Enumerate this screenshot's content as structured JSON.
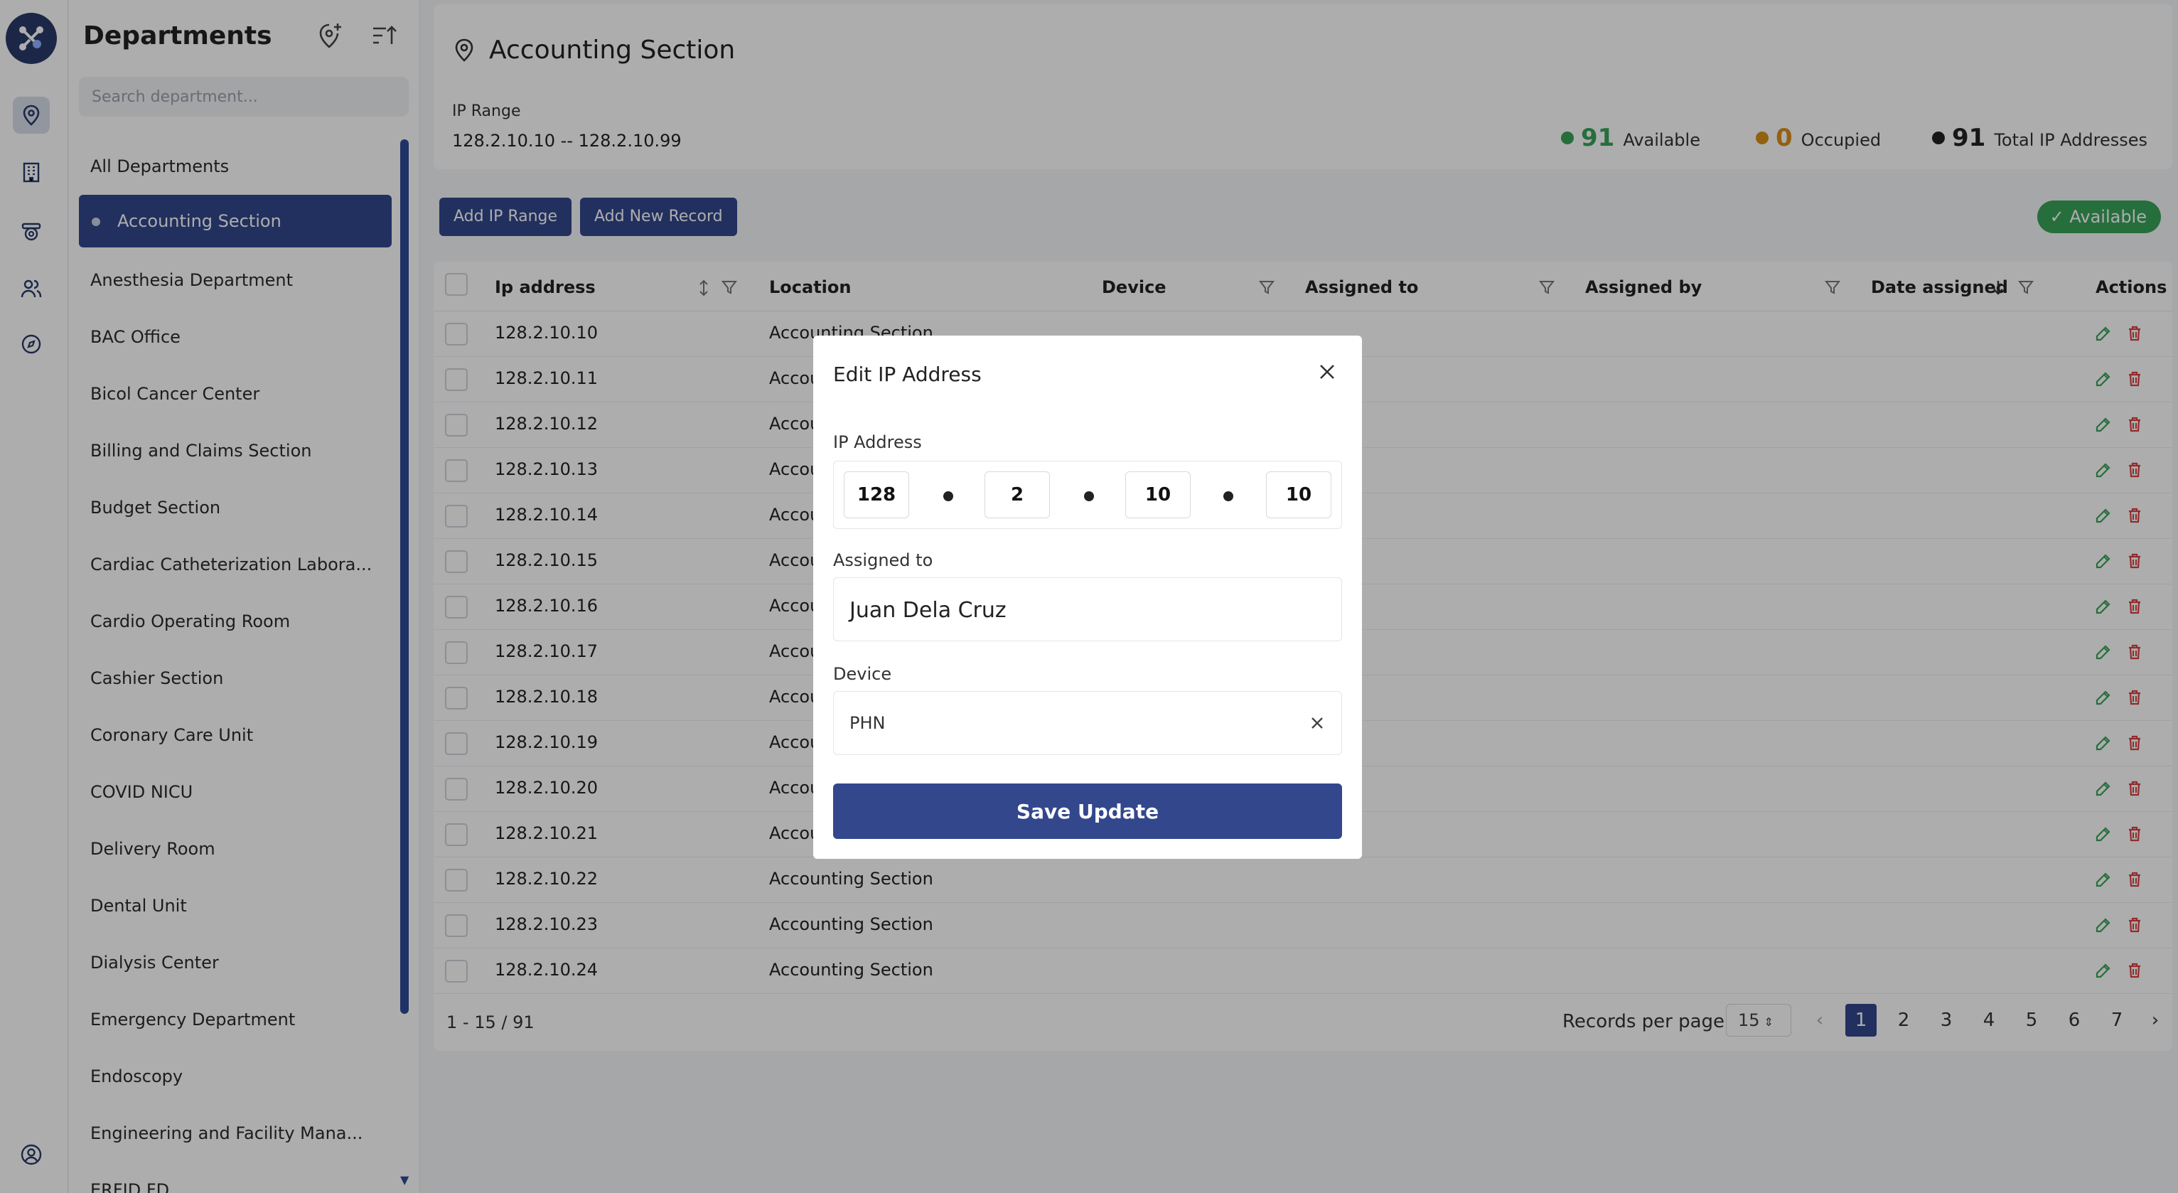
{
  "rail": {
    "items": [
      "location-icon",
      "building-icon",
      "camera-icon",
      "users-icon",
      "compass-icon",
      "account-icon"
    ]
  },
  "sidebar": {
    "title": "Departments",
    "search_placeholder": "Search department...",
    "departments": [
      "All Departments",
      "Accounting Section",
      "Anesthesia Department",
      "BAC Office",
      "Bicol Cancer Center",
      "Billing and Claims Section",
      "Budget Section",
      "Cardiac Catheterization Labora...",
      "Cardio Operating Room",
      "Cashier Section",
      "Coronary Care Unit",
      "COVID NICU",
      "Delivery Room",
      "Dental Unit",
      "Dialysis Center",
      "Emergency Department",
      "Endoscopy",
      "Engineering and Facility Mana...",
      "ERFID FD"
    ],
    "active_index": 1
  },
  "header": {
    "title": "Accounting Section",
    "ip_range_label": "IP Range",
    "ip_range_value": "128.2.10.10 -- 128.2.10.99",
    "stats": [
      {
        "value": "91",
        "label": "Available",
        "color": "#3aa35a"
      },
      {
        "value": "0",
        "label": "Occupied",
        "color": "#d9901a"
      },
      {
        "value": "91",
        "label": "Total IP Addresses",
        "color": "#222222"
      }
    ]
  },
  "toolbar": {
    "add_range_label": "Add IP Range",
    "add_record_label": "Add New Record",
    "available_badge": "Available"
  },
  "table": {
    "columns": [
      "Ip address",
      "Location",
      "Device",
      "Assigned to",
      "Assigned by",
      "Date assigned",
      "Actions"
    ],
    "rows": [
      {
        "ip": "128.2.10.10",
        "location": "Accounting Section"
      },
      {
        "ip": "128.2.10.11",
        "location": "Accou"
      },
      {
        "ip": "128.2.10.12",
        "location": "Accou"
      },
      {
        "ip": "128.2.10.13",
        "location": "Accou"
      },
      {
        "ip": "128.2.10.14",
        "location": "Accou"
      },
      {
        "ip": "128.2.10.15",
        "location": "Accou"
      },
      {
        "ip": "128.2.10.16",
        "location": "Accou"
      },
      {
        "ip": "128.2.10.17",
        "location": "Accou"
      },
      {
        "ip": "128.2.10.18",
        "location": "Accou"
      },
      {
        "ip": "128.2.10.19",
        "location": "Accou"
      },
      {
        "ip": "128.2.10.20",
        "location": "Accou"
      },
      {
        "ip": "128.2.10.21",
        "location": "Accou"
      },
      {
        "ip": "128.2.10.22",
        "location": "Accounting Section"
      },
      {
        "ip": "128.2.10.23",
        "location": "Accounting Section"
      },
      {
        "ip": "128.2.10.24",
        "location": "Accounting Section"
      }
    ]
  },
  "footer": {
    "range_text": "1 - 15 / 91",
    "records_per_page_label": "Records per page",
    "records_per_page_value": "15",
    "pages": [
      "1",
      "2",
      "3",
      "4",
      "5",
      "6",
      "7"
    ],
    "active_page": "1"
  },
  "modal": {
    "title": "Edit IP Address",
    "ip_label": "IP Address",
    "octets": [
      "128",
      "2",
      "10",
      "10"
    ],
    "assigned_label": "Assigned to",
    "assigned_value": "Juan Dela Cruz",
    "device_label": "Device",
    "device_value": "PHN",
    "save_label": "Save Update"
  },
  "colors": {
    "primary": "#33478d",
    "available": "#3aa35a",
    "occupied": "#d9901a",
    "edit_icon": "#3aa35a",
    "delete_icon": "#d94040"
  }
}
